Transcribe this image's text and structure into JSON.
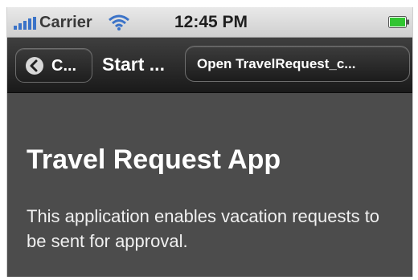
{
  "status_bar": {
    "carrier": "Carrier",
    "time": "12:45 PM",
    "signal_icon": "signal-bars-icon",
    "wifi_icon": "wifi-icon",
    "battery_icon": "battery-icon",
    "battery_color": "#31c531"
  },
  "nav_bar": {
    "back_label": "C...",
    "back_icon": "chevron-left-icon",
    "title": "Start ...",
    "open_button_label": "Open TravelRequest_c..."
  },
  "content": {
    "title": "Travel Request App",
    "description": "This application enables vacation requests to be sent for approval."
  },
  "colors": {
    "nav_background": "#2a2a2a",
    "content_background": "#4c4c4c",
    "text": "#ffffff"
  }
}
